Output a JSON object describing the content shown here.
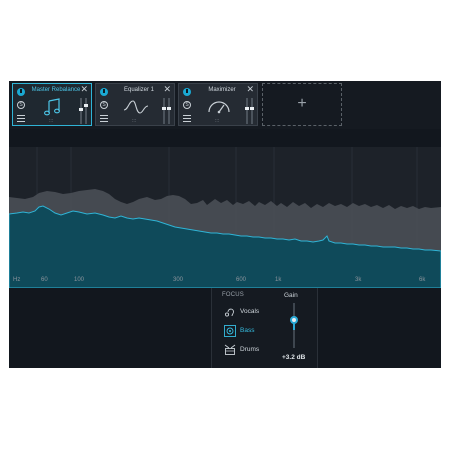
{
  "chain": {
    "modules": [
      {
        "title": "Master Rebalance",
        "active": true,
        "icon": "music-note-icon"
      },
      {
        "title": "Equalizer 1",
        "active": false,
        "icon": "eq-curve-icon"
      },
      {
        "title": "Maximizer",
        "active": false,
        "icon": "gauge-icon"
      }
    ],
    "solo_label": "S",
    "close_glyph": "✕",
    "grip_glyph": ":::",
    "add_glyph": "+"
  },
  "spectrum": {
    "freq_labels": [
      "Hz",
      "60",
      "100",
      "300",
      "600",
      "1k",
      "3k",
      "6k"
    ]
  },
  "focus": {
    "title": "FOCUS",
    "items": [
      {
        "label": "Vocals",
        "icon": "vocals-icon",
        "selected": false
      },
      {
        "label": "Bass",
        "icon": "bass-icon",
        "selected": true
      },
      {
        "label": "Drums",
        "icon": "drums-icon",
        "selected": false
      }
    ]
  },
  "gain": {
    "title": "Gain",
    "value": "+3.2 dB",
    "level": 0.62
  },
  "colors": {
    "accent": "#2fb4d6",
    "background": "#12171e",
    "spectrum_fill": "#0f4a5a"
  }
}
